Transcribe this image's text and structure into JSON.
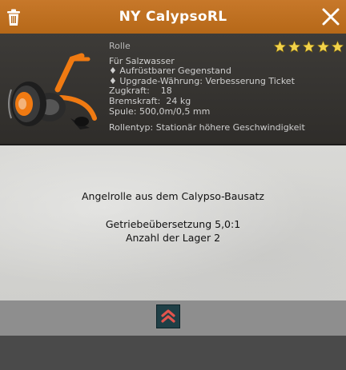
{
  "window": {
    "title": "NY CalypsoRL"
  },
  "item": {
    "category": "Rolle",
    "rating": 5,
    "lines": [
      "Für Salzwasser",
      "♦ Aufrüstbarer Gegenstand",
      "♦ Upgrade-Währung: Verbesserung Ticket",
      "Zugkraft:    18",
      "Bremskraft:  24 kg",
      "Spule: 500,0m/0,5 mm"
    ],
    "reel_type": "Rollentyp: Stationär höhere Geschwindigkeit"
  },
  "description": {
    "line1": "Angelrolle aus dem Calypso-Bausatz",
    "line2": "Getriebeübersetzung 5,0:1",
    "line3": "Anzahl der Lager 2"
  },
  "icons": {
    "trash": "trash-icon",
    "close": "close-icon",
    "upgrade": "upgrade-chevrons-icon",
    "star": "star-icon"
  },
  "colors": {
    "titlebar": "#b66818",
    "star": "#f2d24a",
    "accent_orange": "#f07a12",
    "upgrade_chevron": "#e2544d"
  }
}
